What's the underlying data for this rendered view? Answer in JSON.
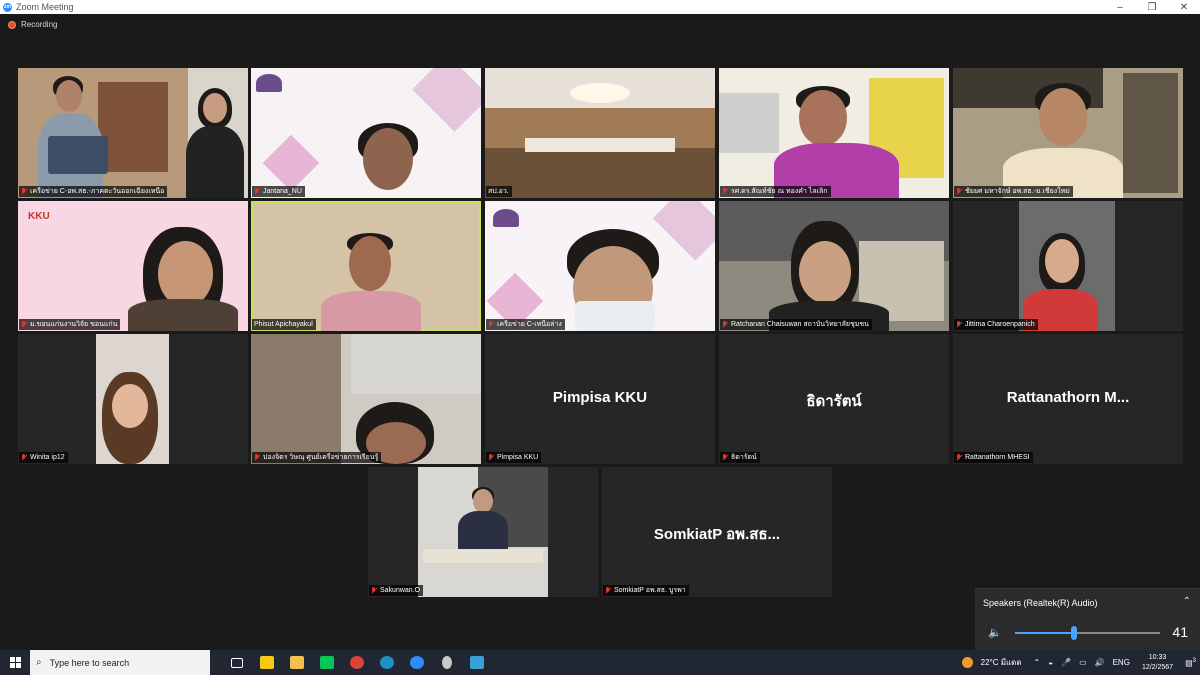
{
  "window": {
    "title": "Zoom Meeting",
    "minimize": "–",
    "maximize": "❐",
    "close": "✕"
  },
  "recording": {
    "label": "Recording"
  },
  "participants": [
    {
      "name": "เครือข่าย C-อพ.สธ.-ภาคตะวันออกเฉียงเหนือ",
      "muted": true
    },
    {
      "name": "Jantana_NU",
      "muted": true
    },
    {
      "name": "สป.อว.",
      "muted": false
    },
    {
      "name": "รศ.ดร.สัณห์ชัย ณ ทองคำ ไลเลิก",
      "muted": true
    },
    {
      "name": "ชัยยศ มหาจักษ์ อพ.สธ.-ม.เชียงใหม่",
      "muted": true
    },
    {
      "name": "ม.ขอนแก่นงานวิจัย ขอนแก่น",
      "muted": true
    },
    {
      "name": "Phisut Apichayakul",
      "muted": false,
      "active_speaker": true
    },
    {
      "name": "เครือข่าย C-เหนือล่าง",
      "muted": true
    },
    {
      "name": "Ratchanan Chaisuwan สถาบันวิทยาลัยชุมชน",
      "muted": true
    },
    {
      "name": "Jittima Charoenpanich",
      "muted": true
    },
    {
      "name": "Winita ip12",
      "muted": true
    },
    {
      "name": "ปองจิตร วิษณุ ศูนย์เครือข่ายการเรียนรู้",
      "muted": true
    },
    {
      "name": "Pimpisa KKU",
      "muted": true,
      "display_name": "Pimpisa KKU"
    },
    {
      "name": "ธิดารัตน์",
      "muted": true,
      "display_name": "ธิดารัตน์"
    },
    {
      "name": "Rattanathorn MHESI",
      "muted": true,
      "display_name": "Rattanathorn  M..."
    },
    {
      "name": "Sakunwan.O",
      "muted": true
    },
    {
      "name": "SomkiatP อพ.สธ. บูรพา",
      "muted": true,
      "display_name": "SomkiatP อพ.สธ..."
    }
  ],
  "speakers_panel": {
    "title": "Speakers (Realtek(R) Audio)",
    "volume": 41,
    "volume_fraction": 0.41
  },
  "taskbar": {
    "search_placeholder": "Type here to search",
    "weather": "22°C  มีแดด",
    "language": "ENG",
    "time": "10:33",
    "date": "12/2/2567",
    "notification_count": "3"
  },
  "colors": {
    "accent": "#4aa3ff",
    "active_outline": "#c8e05a",
    "mute_red": "#e0352d",
    "taskbar": "#202632"
  }
}
